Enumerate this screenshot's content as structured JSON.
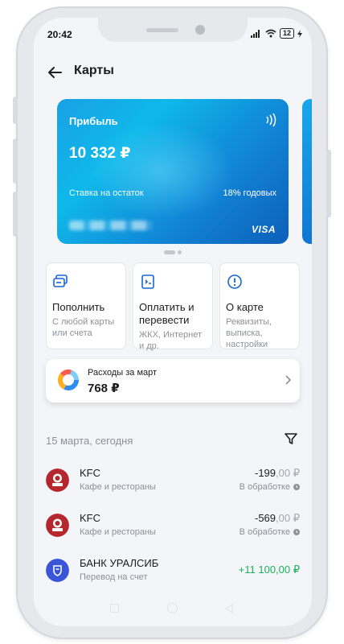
{
  "status_bar": {
    "time": "20:42",
    "battery": "12"
  },
  "header": {
    "title": "Карты"
  },
  "card": {
    "name": "Прибыль",
    "balance": "10 332 ₽",
    "rate_label": "Ставка на остаток",
    "rate_value": "18% годовых",
    "network": "VISA"
  },
  "actions": [
    {
      "label": "Пополнить",
      "sub": "С любой карты или счета",
      "icon": "card-plus-icon"
    },
    {
      "label": "Оплатить и перевести",
      "sub": "ЖКХ, Интернет и др.",
      "icon": "receipt-icon"
    },
    {
      "label": "О карте",
      "sub": "Реквизиты, выписка, настройки",
      "icon": "info-icon"
    }
  ],
  "expenses": {
    "title": "Расходы за март",
    "amount": "768 ₽"
  },
  "history": {
    "date_header": "15 марта, сегодня",
    "transactions": [
      {
        "merchant": "KFC",
        "category": "Кафе и рестораны",
        "amount_main": "-199",
        "amount_cents": ",00 ₽",
        "state": "В обработке",
        "logo": "kfc-logo"
      },
      {
        "merchant": "KFC",
        "category": "Кафе и рестораны",
        "amount_main": "-569",
        "amount_cents": ",00 ₽",
        "state": "В обработке",
        "logo": "kfc-logo"
      },
      {
        "merchant": "БАНК УРАЛСИБ",
        "category": "Перевод на счет",
        "amount_full": "+11 100,00 ₽",
        "logo": "uralsib-logo"
      }
    ]
  },
  "colors": {
    "accent": "#1565d8",
    "positive": "#19b15a",
    "background": "#f4f5f8"
  }
}
